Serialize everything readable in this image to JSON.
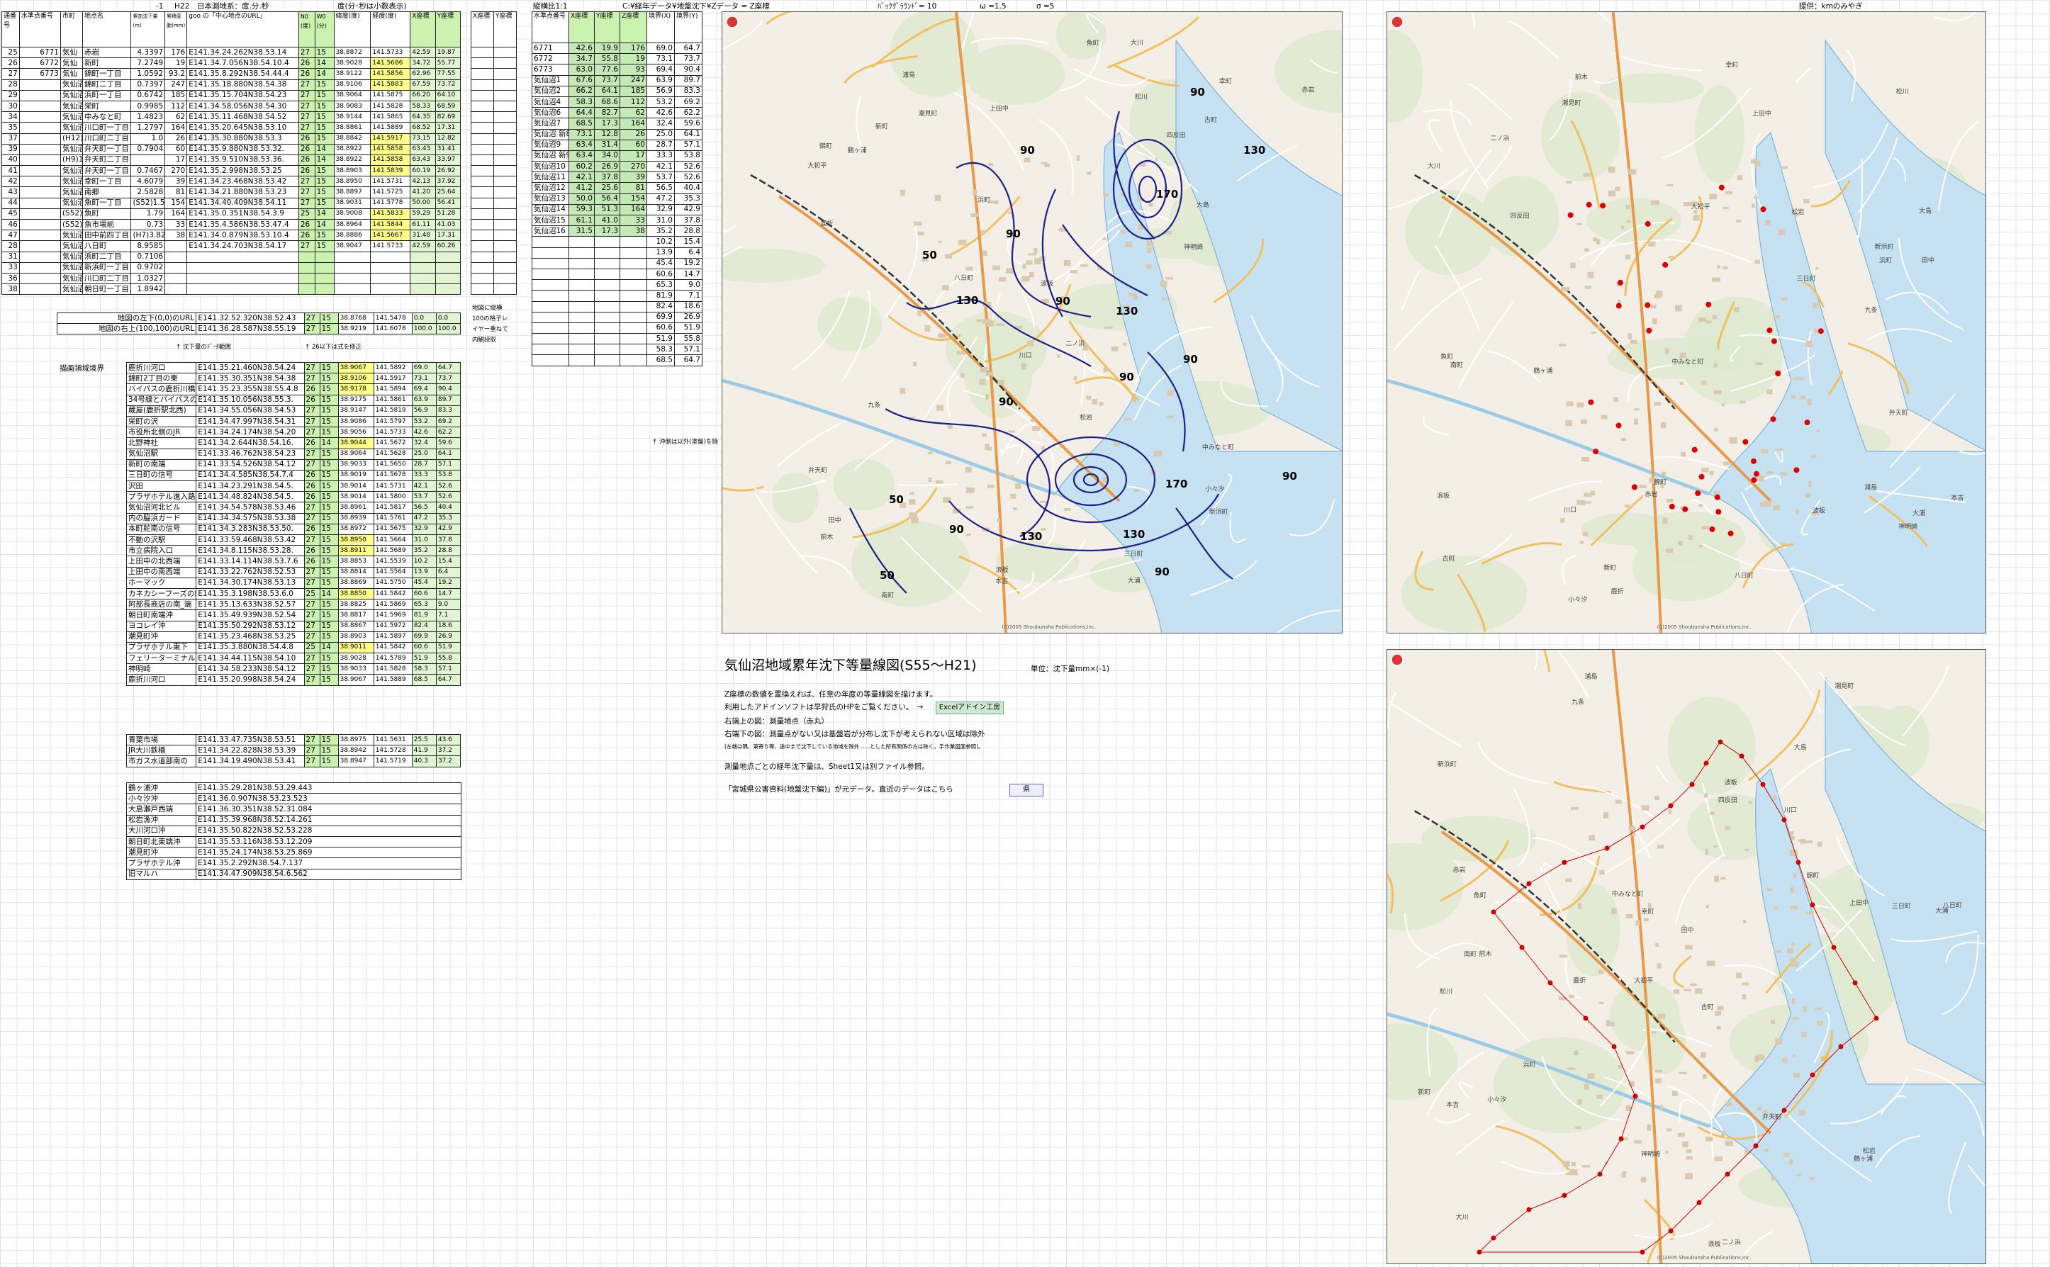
{
  "sheet": {
    "header": {
      "r1": "-1",
      "h22": "H22",
      "datum": "日本測地系：度.分.秒",
      "deg_label": "度(分･秒は小数表示)",
      "ratio": "縦横比1:1",
      "data_path": "C:¥経年データ¥地盤沈下¥Zデータ = Z座標",
      "bg": "ﾊﾞｯｸｸﾞﾗｳﾝﾄﾞ= 10",
      "omega": "ω =1.5",
      "sigma": "σ =5",
      "credit": "提供：kmのみやぎ"
    },
    "cols": {
      "c1": "通番号",
      "c2": "水準点番号",
      "c3": "市町",
      "c4": "地点名",
      "c5": "累加沈下量(m)",
      "c6": "累積変動(mm)",
      "c7": "goo の「中心地点のURL」",
      "c8": "N0 (度)",
      "c9": "W0 (分)",
      "c10": "緯度(度)",
      "c11": "経度(度)",
      "c12": "X座標",
      "c13": "Y座標"
    },
    "colsB": {
      "a": "X座標",
      "b": "Y座標"
    },
    "colsC": {
      "a": "水準点番号",
      "b": "X座標",
      "c": "Y座標",
      "d": "Z座標",
      "e": "境界(X)",
      "f": "境界(Y)"
    },
    "rows": [
      [
        "25",
        "6771",
        "気仙",
        "赤岩",
        "4.3397",
        "176",
        "E141.34.24.262N38.53.14",
        "27",
        "15",
        "38.8872",
        "141.5733",
        "42.59",
        "19.87"
      ],
      [
        "26",
        "6772",
        "気仙",
        "新町",
        "7.2749",
        "19",
        "E141.34.7.056N38.54.10.4",
        "26",
        "14",
        "38.9028",
        "141.5686",
        "34.72",
        "55.77"
      ],
      [
        "27",
        "6773",
        "気仙",
        "錦町一丁目",
        "1.0592",
        "93.2",
        "E141.35.8.292N38.54.44.4",
        "26",
        "14",
        "38.9122",
        "141.5856",
        "62.96",
        "77.55"
      ],
      [
        "28",
        "",
        "気仙沼1",
        "錦町二丁目",
        "0.7397",
        "247",
        "E141.35.18.880N38.54.38",
        "27",
        "15",
        "38.9106",
        "141.5883",
        "67.59",
        "73.72"
      ],
      [
        "29",
        "",
        "気仙沼2",
        "浜町一丁目",
        "0.6742",
        "185",
        "E141.35.15.704N38.54.23",
        "27",
        "15",
        "38.9064",
        "141.5875",
        "66.20",
        "64.10"
      ],
      [
        "30",
        "",
        "気仙沼4",
        "栄町",
        "0.9985",
        "112",
        "E141.34.58.056N38.54.30",
        "27",
        "15",
        "38.9083",
        "141.5828",
        "58.33",
        "68.59"
      ],
      [
        "34",
        "",
        "気仙沼6",
        "中みなと町",
        "1.4823",
        "62",
        "E141.35.11.468N38.54.52",
        "27",
        "15",
        "38.9144",
        "141.5865",
        "64.35",
        "82.69"
      ],
      [
        "35",
        "",
        "気仙沼7",
        "川口町一丁目",
        "1.2797",
        "164",
        "E141.35.20.645N38.53.10",
        "27",
        "15",
        "38.8861",
        "141.5889",
        "68.52",
        "17.31"
      ],
      [
        "37",
        "",
        "(H12)",
        "川口町二丁目",
        "1.0",
        "26",
        "E141.35.30.880N38.53.3",
        "26",
        "15",
        "38.8842",
        "141.5917",
        "73.15",
        "12.82"
      ],
      [
        "39",
        "",
        "気仙沼9",
        "弁天町一丁目",
        "0.7904",
        "60",
        "E141.35.9.880N38.53.32.",
        "26",
        "14",
        "38.8922",
        "141.5858",
        "63.43",
        "31.41"
      ],
      [
        "40",
        "",
        "(H9)1.2097",
        "弁天町二丁目",
        "",
        "17",
        "E141.35.9.510N38.53.36.",
        "26",
        "14",
        "38.8922",
        "141.5858",
        "63.43",
        "33.97"
      ],
      [
        "41",
        "",
        "気仙沼10",
        "弁天町一丁目",
        "0.7467",
        "270",
        "E141.35.2.998N38.53.25",
        "26",
        "15",
        "38.8903",
        "141.5839",
        "60.19",
        "26.92"
      ],
      [
        "42",
        "",
        "気仙沼11",
        "幸町一丁目",
        "4.6079",
        "39",
        "E141.34.23.468N38.53.42",
        "27",
        "15",
        "38.8950",
        "141.5731",
        "42.13",
        "37.92"
      ],
      [
        "43",
        "",
        "気仙沼12",
        "南郷",
        "2.5828",
        "81",
        "E141.34.21.880N38.53.23",
        "27",
        "15",
        "38.8897",
        "141.5725",
        "41.20",
        "25.64"
      ],
      [
        "44",
        "",
        "気仙沼13",
        "魚町一丁目",
        "(S52)1.50",
        "154",
        "E141.34.40.409N38.54.11",
        "27",
        "15",
        "38.9031",
        "141.5778",
        "50.00",
        "56.41"
      ],
      [
        "45",
        "",
        "(S52)",
        "魚町",
        "1.79",
        "164",
        "E141.35.0.351N38.54.3.9",
        "25",
        "14",
        "38.9008",
        "141.5833",
        "59.29",
        "51.28"
      ],
      [
        "46",
        "",
        "(S52)",
        "魚市場前",
        "0.73",
        "33",
        "E141.35.4.586N38.53.47.4",
        "26",
        "14",
        "38.8964",
        "141.5844",
        "61.11",
        "41.03"
      ],
      [
        "47",
        "",
        "気仙沼16",
        "田中前四丁目",
        "(H7)3.8252",
        "38",
        "E141.34.0.879N38.53.10.4",
        "26",
        "15",
        "38.8886",
        "141.5667",
        "31.48",
        "17.31"
      ],
      [
        "28",
        "",
        "気仙沼",
        "八日町",
        "8.9585",
        "",
        "E141.34.24.703N38.54.17",
        "27",
        "15",
        "38.9047",
        "141.5733",
        "42.59",
        "60.26"
      ],
      [
        "31",
        "",
        "気仙沼3",
        "浜町二丁目",
        "0.7106",
        "",
        "",
        "",
        "",
        "",
        "",
        "",
        ""
      ],
      [
        "33",
        "",
        "気仙沼5",
        "新浜町一丁目",
        "0.9702",
        "",
        "",
        "",
        "",
        "",
        "",
        "",
        ""
      ],
      [
        "36",
        "",
        "気仙沼8",
        "川口町二丁目",
        "1.0327",
        "",
        "",
        "",
        "",
        "",
        "",
        "",
        ""
      ],
      [
        "38",
        "",
        "気仙沼",
        "朝日町一丁目",
        "1.8942",
        "",
        "",
        "",
        "",
        "",
        "",
        "",
        ""
      ]
    ],
    "corner_rows": [
      [
        "地図の左下(0,0)のURL",
        "E141.32.52.320N38.52.43",
        "27",
        "15",
        "38.8768",
        "141.5478",
        "0.0",
        "0.0"
      ],
      [
        "地図の右上(100,100)のURL",
        "E141.36.28.587N38.55.19",
        "27",
        "15",
        "38.9219",
        "141.6078",
        "100.0",
        "100.0"
      ]
    ],
    "note_a": "↑ 沈下量のﾃﾞｰﾀ範囲",
    "note_b": "↑ 26以下は式を修正",
    "side_note": [
      "地図に縦横",
      "100の格子レ",
      "イヤー重ねて",
      "内観読取"
    ],
    "label_bound": "描画領域境界",
    "rows2": [
      [
        "鹿折川河口",
        "E141.35.21.460N38.54.24",
        "27",
        "15",
        "38.9067",
        "141.5892",
        "69.0",
        "64.7"
      ],
      [
        "錦町2丁目の東",
        "E141.35.30.351N38.54.38",
        "27",
        "15",
        "38.9106",
        "141.5917",
        "73.1",
        "73.7"
      ],
      [
        "バイパスの鹿折川橋",
        "E141.35.23.355N38.55.4.8",
        "26",
        "15",
        "38.9178",
        "141.5894",
        "69.4",
        "90.4"
      ],
      [
        "34号線とバイパスの",
        "E141.35.10.056N38.55.3.",
        "26",
        "15",
        "38.9175",
        "141.5861",
        "63.9",
        "89.7"
      ],
      [
        "蔵屋(鹿折駅北西)",
        "E141.34.55.056N38.54.53",
        "27",
        "15",
        "38.9147",
        "141.5819",
        "56.9",
        "83.3"
      ],
      [
        "栄町の沢",
        "E141.34.47.997N38.54.31",
        "27",
        "15",
        "38.9086",
        "141.5797",
        "53.2",
        "69.2"
      ],
      [
        "市役所北側のJR",
        "E141.34.24.174N38.54.20",
        "27",
        "15",
        "38.9056",
        "141.5733",
        "42.6",
        "62.2"
      ],
      [
        "北野神社",
        "E141.34.2.644N38.54.16.",
        "26",
        "14",
        "38.9044",
        "141.5672",
        "32.4",
        "59.6"
      ],
      [
        "気仙沼駅",
        "E141.33.46.762N38.54.23",
        "27",
        "15",
        "38.9064",
        "141.5628",
        "25.0",
        "64.1"
      ],
      [
        "新町の南端",
        "E141.33.54.526N38.54.12",
        "27",
        "15",
        "38.9033",
        "141.5650",
        "28.7",
        "57.1"
      ],
      [
        "三日町の信号",
        "E141.34.4.585N38.54.7.4",
        "26",
        "15",
        "38.9019",
        "141.5678",
        "33.3",
        "53.8"
      ],
      [
        "沢田",
        "E141.34.23.291N38.54.5.",
        "26",
        "15",
        "38.9014",
        "141.5731",
        "42.1",
        "52.6"
      ],
      [
        "プラザホテル進入路",
        "E141.34.48.824N38.54.5.",
        "26",
        "15",
        "38.9014",
        "141.5800",
        "53.7",
        "52.6"
      ],
      [
        "気仙沼河北ビル",
        "E141.34.54.578N38.53.46",
        "27",
        "15",
        "38.8961",
        "141.5817",
        "56.5",
        "40.4"
      ],
      [
        "内の脇浜ガード",
        "E141.34.34.575N38.53.38",
        "27",
        "15",
        "38.8939",
        "141.5761",
        "47.2",
        "35.3"
      ],
      [
        "本町舵南の信号",
        "E141.34.3.283N38.53.50.",
        "26",
        "15",
        "38.8972",
        "141.5675",
        "32.9",
        "42.9"
      ],
      [
        "不動の沢駅",
        "E141.33.59.468N38.53.42",
        "27",
        "15",
        "38.8950",
        "141.5664",
        "31.0",
        "37.8"
      ],
      [
        "市立病院入口",
        "E141.34.8.115N38.53.28.",
        "26",
        "15",
        "38.8911",
        "141.5689",
        "35.2",
        "28.8"
      ],
      [
        "上田中の北西端",
        "E141.33.14.114N38.53.7.6",
        "26",
        "15",
        "38.8853",
        "141.5539",
        "10.2",
        "15.4"
      ],
      [
        "上田中の南西端",
        "E141.33.22.762N38.52.53",
        "27",
        "15",
        "38.8814",
        "141.5564",
        "13.9",
        "6.4"
      ],
      [
        "ホーマック",
        "E141.34.30.174N38.53.13",
        "27",
        "15",
        "38.8869",
        "141.5750",
        "45.4",
        "19.2"
      ],
      [
        "カネカシーフーズの端",
        "E141.35.3.198N38.53.6.0",
        "25",
        "14",
        "38.8850",
        "141.5842",
        "60.6",
        "14.7"
      ],
      [
        "阿部長商店の南_端",
        "E141.35.13.633N38.52.57",
        "27",
        "15",
        "38.8825",
        "141.5869",
        "65.3",
        "9.0"
      ],
      [
        "朝日町南端沖",
        "E141.35.49.939N38.52.54",
        "27",
        "15",
        "38.8817",
        "141.5969",
        "81.9",
        "7.1"
      ],
      [
        "ヨコレイ沖",
        "E141.35.50.292N38.53.12",
        "27",
        "15",
        "38.8867",
        "141.5972",
        "82.4",
        "18.6"
      ],
      [
        "潮見町沖",
        "E141.35.23.468N38.53.25",
        "27",
        "15",
        "38.8903",
        "141.5897",
        "69.9",
        "26.9"
      ],
      [
        "プラザホテル東下",
        "E141.35.3.880N38.54.4.8",
        "25",
        "14",
        "38.9011",
        "141.5842",
        "60.6",
        "51.9"
      ],
      [
        "フェリーターミナル",
        "E141.34.44.115N38.54.10",
        "27",
        "15",
        "38.9028",
        "141.5789",
        "51.9",
        "55.8"
      ],
      [
        "神明崎",
        "E141.34.58.233N38.54.12",
        "27",
        "15",
        "38.9033",
        "141.5828",
        "58.3",
        "57.1"
      ],
      [
        "鹿折川河口",
        "E141.35.20.998N38.54.24",
        "27",
        "15",
        "38.9067",
        "141.5889",
        "68.5",
        "64.7"
      ]
    ],
    "rows3": [
      [
        "青葉市場",
        "E141.33.47.735N38.53.51",
        "27",
        "15",
        "38.8975",
        "141.5631",
        "25.5",
        "43.6"
      ],
      [
        "JR大川鉄橋",
        "E141.34.22.828N38.53.39",
        "27",
        "15",
        "38.8942",
        "141.5728",
        "41.9",
        "37.2"
      ],
      [
        "市ガス水道部南の",
        "E141.34.19.490N38.53.41",
        "27",
        "15",
        "38.8947",
        "141.5719",
        "40.3",
        "37.2"
      ]
    ],
    "rows4": [
      [
        "鶴ヶ浦沖",
        "E141.35.29.281N38.53.29.443"
      ],
      [
        "小々汐沖",
        "E141.36.0.907N38.53.23.523"
      ],
      [
        "大島瀬戸西端",
        "E141.36.30.351N38.52.31.084"
      ],
      [
        "松岩漁沖",
        "E141.35.39.968N38.52.14.261"
      ],
      [
        "大川河口沖",
        "E141.35.50.822N38.52.53.228"
      ],
      [
        "朝日町北東端沖",
        "E141.35.53.116N38.53.12.209"
      ],
      [
        "潮見町沖",
        "E141.35.24.174N38.53.25.869"
      ],
      [
        "プラザホテル沖",
        "E141.35.2.292N38.54.7.137"
      ],
      [
        "旧マルハ",
        "E141.34.47.909N38.54.6.562"
      ]
    ],
    "tableC": [
      [
        "6771",
        "42.6",
        "19.9",
        "176",
        "69.0",
        "64.7"
      ],
      [
        "6772",
        "34.7",
        "55.8",
        "19",
        "73.1",
        "73.7"
      ],
      [
        "6773",
        "63.0",
        "77.6",
        "93",
        "69.4",
        "90.4"
      ],
      [
        "気仙沼1",
        "67.6",
        "73.7",
        "247",
        "63.9",
        "89.7"
      ],
      [
        "気仙沼2",
        "66.2",
        "64.1",
        "185",
        "56.9",
        "83.3"
      ],
      [
        "気仙沼4",
        "58.3",
        "68.6",
        "112",
        "53.2",
        "69.2"
      ],
      [
        "気仙沼6",
        "64.4",
        "82.7",
        "62",
        "42.6",
        "62.2"
      ],
      [
        "気仙沼7",
        "68.5",
        "17.3",
        "164",
        "32.4",
        "59.6"
      ],
      [
        "気仙沼 新8",
        "73.1",
        "12.8",
        "26",
        "25.0",
        "64.1"
      ],
      [
        "気仙沼9",
        "63.4",
        "31.4",
        "60",
        "28.7",
        "57.1"
      ],
      [
        "気仙沼 新9",
        "63.4",
        "34.0",
        "17",
        "33.3",
        "53.8"
      ],
      [
        "気仙沼10",
        "60.2",
        "26.9",
        "270",
        "42.1",
        "52.6"
      ],
      [
        "気仙沼11",
        "42.1",
        "37.8",
        "39",
        "53.7",
        "52.6"
      ],
      [
        "気仙沼12",
        "41.2",
        "25.6",
        "81",
        "56.5",
        "40.4"
      ],
      [
        "気仙沼13",
        "50.0",
        "56.4",
        "154",
        "47.2",
        "35.3"
      ],
      [
        "気仙沼14",
        "59.3",
        "51.3",
        "164",
        "32.9",
        "42.9"
      ],
      [
        "気仙沼15",
        "61.1",
        "41.0",
        "33",
        "31.0",
        "37.8"
      ],
      [
        "気仙沼16",
        "31.5",
        "17.3",
        "38",
        "35.2",
        "28.8"
      ]
    ],
    "boundary_extra": [
      [
        "10.2",
        "15.4"
      ],
      [
        "13.9",
        "6.4"
      ],
      [
        "45.4",
        "19.2"
      ],
      [
        "60.6",
        "14.7"
      ],
      [
        "65.3",
        "9.0"
      ],
      [
        "81.9",
        "7.1"
      ],
      [
        "82.4",
        "18.6"
      ],
      [
        "69.9",
        "26.9"
      ],
      [
        "60.6",
        "51.9"
      ],
      [
        "51.9",
        "55.8"
      ],
      [
        "58.3",
        "57.1"
      ],
      [
        "68.5",
        "64.7"
      ]
    ],
    "note_c": "↑ 沖側は以外(塗盤)を除",
    "panel": {
      "title": "気仙沼地域累年沈下等量線図(S55〜H21)",
      "unit": "単位：沈下量mm×(-1)",
      "l1": "Z座標の数値を置換えれば、任意の年度の等量線図を描けます。",
      "l2": "利用したアドインソフトは早狩氏のHPをご覧ください。　→",
      "addin_btn": "Excelアドイン工房",
      "l3": "右端上の図：測量地点（赤丸）",
      "l4": "右端下の図：測量点がない又は基盤岩が分布し沈下が考えられない区域は除外",
      "l4b": "(左端は隅、東寄り等、途中まで沈下している地域を除外……とした所有関係の方は除く。手作業図面参照)。",
      "l5": "測量地点ごとの経年沈下量は、Sheet1又は別ファイル参照。",
      "l6": "「宮城県公害資料(地盤沈下編)」が元データ。直近のデータはこちら",
      "go_btn": "県"
    },
    "map": {
      "places": [
        "浦島",
        "大島",
        "大浦",
        "大初平",
        "古町",
        "前木",
        "新浜町",
        "川口",
        "松川",
        "四反田",
        "田中",
        "大川",
        "九条",
        "鹿折",
        "浪板",
        "二ノ浜",
        "神明崎",
        "潮見町",
        "錦町",
        "浜町",
        "魚町",
        "南町",
        "八日町",
        "三日町",
        "新町",
        "赤岩",
        "幸町",
        "上田中",
        "松岩",
        "本吉",
        "鶴ヶ浦",
        "波板",
        "小々汐",
        "中みなと町",
        "弁天町"
      ],
      "contours": [
        "90",
        "90",
        "130",
        "170",
        "90",
        "50",
        "90",
        "130",
        "90",
        "90",
        "130",
        "170",
        "90",
        "50",
        "130",
        "90",
        "90"
      ],
      "credit": "(C)2005 Shoubunsha Publications,Inc."
    }
  }
}
